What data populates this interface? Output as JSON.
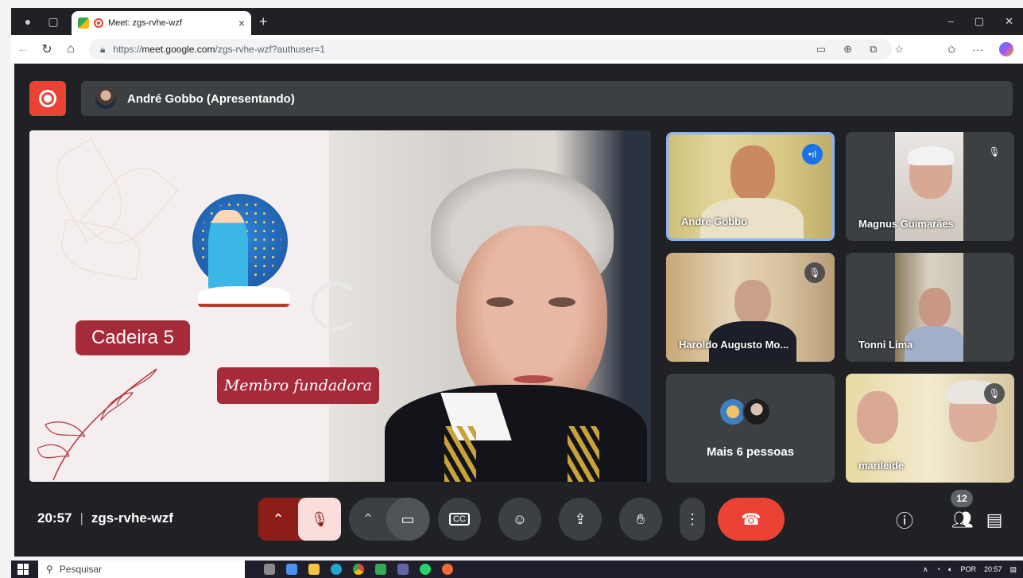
{
  "browser": {
    "tab_title": "Meet: zgs-rvhe-wzf",
    "tab_close": "×",
    "new_tab": "+",
    "url_prefix": "https://",
    "url_host": "meet.google.com",
    "url_path": "/zgs-rvhe-wzf?authuser=1",
    "window_controls": [
      "–",
      "▢",
      "✕"
    ]
  },
  "presenter": {
    "label": "André Gobbo (Apresentando)"
  },
  "slide": {
    "cadeira": "Cadeira 5",
    "membro": "Membro fundadora"
  },
  "participants": [
    {
      "name": "Andre Gobbo",
      "speaking": true,
      "muted": false
    },
    {
      "name": "Magnus Guimarães",
      "speaking": false,
      "muted": true
    },
    {
      "name": "Haroldo Augusto Mo...",
      "speaking": false,
      "muted": true
    },
    {
      "name": "Tonni Lima",
      "speaking": false,
      "muted": false
    },
    {
      "name": "marileide",
      "speaking": false,
      "muted": true
    }
  ],
  "more_people": "Mais 6 pessoas",
  "meeting": {
    "time": "20:57",
    "separator": "|",
    "code": "zgs-rvhe-wzf",
    "participant_count": "12"
  },
  "taskbar": {
    "search_placeholder": "Pesquisar",
    "language": "POR",
    "clock": "20:57"
  },
  "colors": {
    "meet_bg": "#202124",
    "record_red": "#ea4335",
    "slide_accent": "#a52a3a",
    "active_border": "#8ab4f8"
  }
}
